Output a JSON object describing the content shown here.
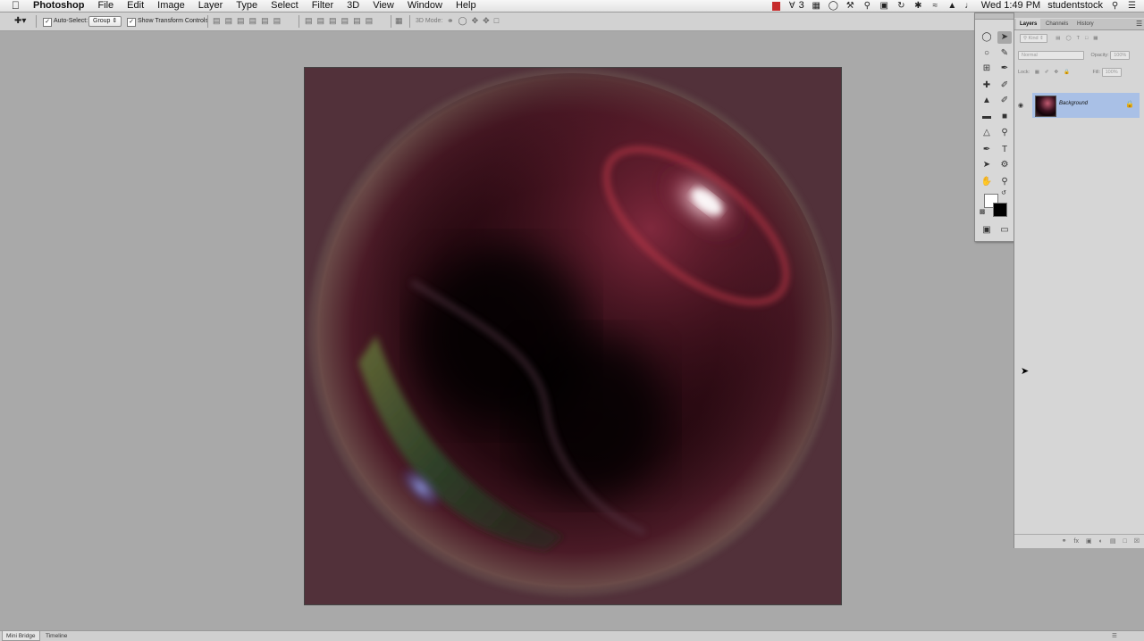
{
  "menubar": {
    "apple": "",
    "items": [
      "Photoshop",
      "File",
      "Edit",
      "Image",
      "Layer",
      "Type",
      "Select",
      "Filter",
      "3D",
      "View",
      "Window",
      "Help"
    ],
    "status_num": "3",
    "clock": "Wed 1:49 PM",
    "user": "studentstock"
  },
  "options": {
    "auto_select_label": "Auto-Select:",
    "auto_select_value": "Group",
    "transform_label": "Show Transform Controls",
    "mode_label": "3D Mode:"
  },
  "panel": {
    "tabs": [
      "Layers",
      "Channels",
      "History"
    ],
    "filter_kind": "Kind",
    "blend_mode": "Normal",
    "opacity_label": "Opacity:",
    "opacity_value": "100%",
    "lock_label": "Lock:",
    "fill_label": "Fill:",
    "fill_value": "100%",
    "layer_name": "Background"
  },
  "bottom": {
    "tabs": [
      "Mini Bridge",
      "Timeline"
    ]
  },
  "colors": {
    "canvas_bg": "#52313a",
    "workspace": "#a9a9a9",
    "selected_layer": "#a9c0e6"
  }
}
